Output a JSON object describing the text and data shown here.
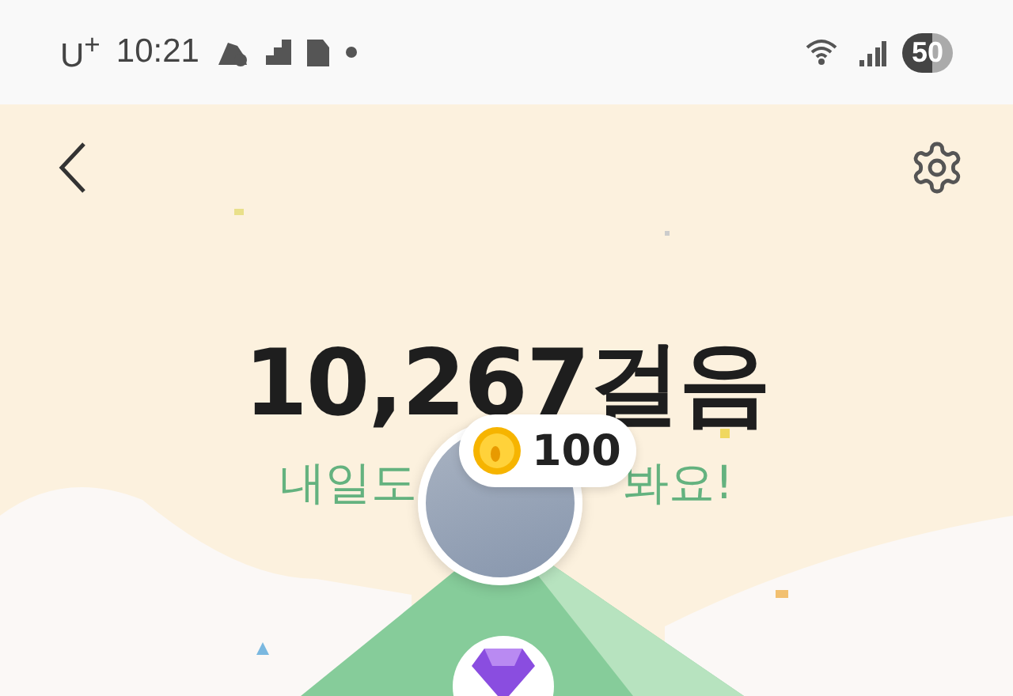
{
  "status_bar": {
    "carrier": "U$^{+}$",
    "time": "10:21",
    "battery": "50"
  },
  "steps": {
    "count": "10,267걸음",
    "message_start": "내일도",
    "message_end": "봐요!"
  },
  "reward": {
    "amount": "100"
  }
}
